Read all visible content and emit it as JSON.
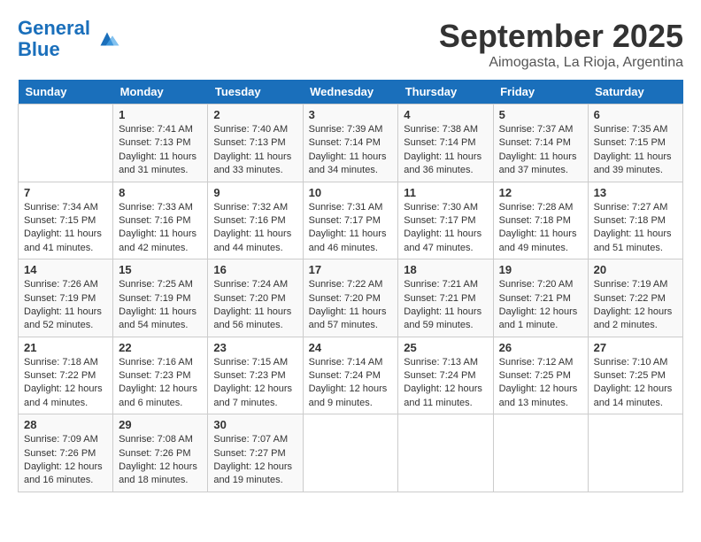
{
  "header": {
    "logo_line1": "General",
    "logo_line2": "Blue",
    "month_title": "September 2025",
    "location": "Aimogasta, La Rioja, Argentina"
  },
  "days_of_week": [
    "Sunday",
    "Monday",
    "Tuesday",
    "Wednesday",
    "Thursday",
    "Friday",
    "Saturday"
  ],
  "weeks": [
    [
      {
        "day": "",
        "info": ""
      },
      {
        "day": "1",
        "info": "Sunrise: 7:41 AM\nSunset: 7:13 PM\nDaylight: 11 hours and 31 minutes."
      },
      {
        "day": "2",
        "info": "Sunrise: 7:40 AM\nSunset: 7:13 PM\nDaylight: 11 hours and 33 minutes."
      },
      {
        "day": "3",
        "info": "Sunrise: 7:39 AM\nSunset: 7:14 PM\nDaylight: 11 hours and 34 minutes."
      },
      {
        "day": "4",
        "info": "Sunrise: 7:38 AM\nSunset: 7:14 PM\nDaylight: 11 hours and 36 minutes."
      },
      {
        "day": "5",
        "info": "Sunrise: 7:37 AM\nSunset: 7:14 PM\nDaylight: 11 hours and 37 minutes."
      },
      {
        "day": "6",
        "info": "Sunrise: 7:35 AM\nSunset: 7:15 PM\nDaylight: 11 hours and 39 minutes."
      }
    ],
    [
      {
        "day": "7",
        "info": "Sunrise: 7:34 AM\nSunset: 7:15 PM\nDaylight: 11 hours and 41 minutes."
      },
      {
        "day": "8",
        "info": "Sunrise: 7:33 AM\nSunset: 7:16 PM\nDaylight: 11 hours and 42 minutes."
      },
      {
        "day": "9",
        "info": "Sunrise: 7:32 AM\nSunset: 7:16 PM\nDaylight: 11 hours and 44 minutes."
      },
      {
        "day": "10",
        "info": "Sunrise: 7:31 AM\nSunset: 7:17 PM\nDaylight: 11 hours and 46 minutes."
      },
      {
        "day": "11",
        "info": "Sunrise: 7:30 AM\nSunset: 7:17 PM\nDaylight: 11 hours and 47 minutes."
      },
      {
        "day": "12",
        "info": "Sunrise: 7:28 AM\nSunset: 7:18 PM\nDaylight: 11 hours and 49 minutes."
      },
      {
        "day": "13",
        "info": "Sunrise: 7:27 AM\nSunset: 7:18 PM\nDaylight: 11 hours and 51 minutes."
      }
    ],
    [
      {
        "day": "14",
        "info": "Sunrise: 7:26 AM\nSunset: 7:19 PM\nDaylight: 11 hours and 52 minutes."
      },
      {
        "day": "15",
        "info": "Sunrise: 7:25 AM\nSunset: 7:19 PM\nDaylight: 11 hours and 54 minutes."
      },
      {
        "day": "16",
        "info": "Sunrise: 7:24 AM\nSunset: 7:20 PM\nDaylight: 11 hours and 56 minutes."
      },
      {
        "day": "17",
        "info": "Sunrise: 7:22 AM\nSunset: 7:20 PM\nDaylight: 11 hours and 57 minutes."
      },
      {
        "day": "18",
        "info": "Sunrise: 7:21 AM\nSunset: 7:21 PM\nDaylight: 11 hours and 59 minutes."
      },
      {
        "day": "19",
        "info": "Sunrise: 7:20 AM\nSunset: 7:21 PM\nDaylight: 12 hours and 1 minute."
      },
      {
        "day": "20",
        "info": "Sunrise: 7:19 AM\nSunset: 7:22 PM\nDaylight: 12 hours and 2 minutes."
      }
    ],
    [
      {
        "day": "21",
        "info": "Sunrise: 7:18 AM\nSunset: 7:22 PM\nDaylight: 12 hours and 4 minutes."
      },
      {
        "day": "22",
        "info": "Sunrise: 7:16 AM\nSunset: 7:23 PM\nDaylight: 12 hours and 6 minutes."
      },
      {
        "day": "23",
        "info": "Sunrise: 7:15 AM\nSunset: 7:23 PM\nDaylight: 12 hours and 7 minutes."
      },
      {
        "day": "24",
        "info": "Sunrise: 7:14 AM\nSunset: 7:24 PM\nDaylight: 12 hours and 9 minutes."
      },
      {
        "day": "25",
        "info": "Sunrise: 7:13 AM\nSunset: 7:24 PM\nDaylight: 12 hours and 11 minutes."
      },
      {
        "day": "26",
        "info": "Sunrise: 7:12 AM\nSunset: 7:25 PM\nDaylight: 12 hours and 13 minutes."
      },
      {
        "day": "27",
        "info": "Sunrise: 7:10 AM\nSunset: 7:25 PM\nDaylight: 12 hours and 14 minutes."
      }
    ],
    [
      {
        "day": "28",
        "info": "Sunrise: 7:09 AM\nSunset: 7:26 PM\nDaylight: 12 hours and 16 minutes."
      },
      {
        "day": "29",
        "info": "Sunrise: 7:08 AM\nSunset: 7:26 PM\nDaylight: 12 hours and 18 minutes."
      },
      {
        "day": "30",
        "info": "Sunrise: 7:07 AM\nSunset: 7:27 PM\nDaylight: 12 hours and 19 minutes."
      },
      {
        "day": "",
        "info": ""
      },
      {
        "day": "",
        "info": ""
      },
      {
        "day": "",
        "info": ""
      },
      {
        "day": "",
        "info": ""
      }
    ]
  ]
}
